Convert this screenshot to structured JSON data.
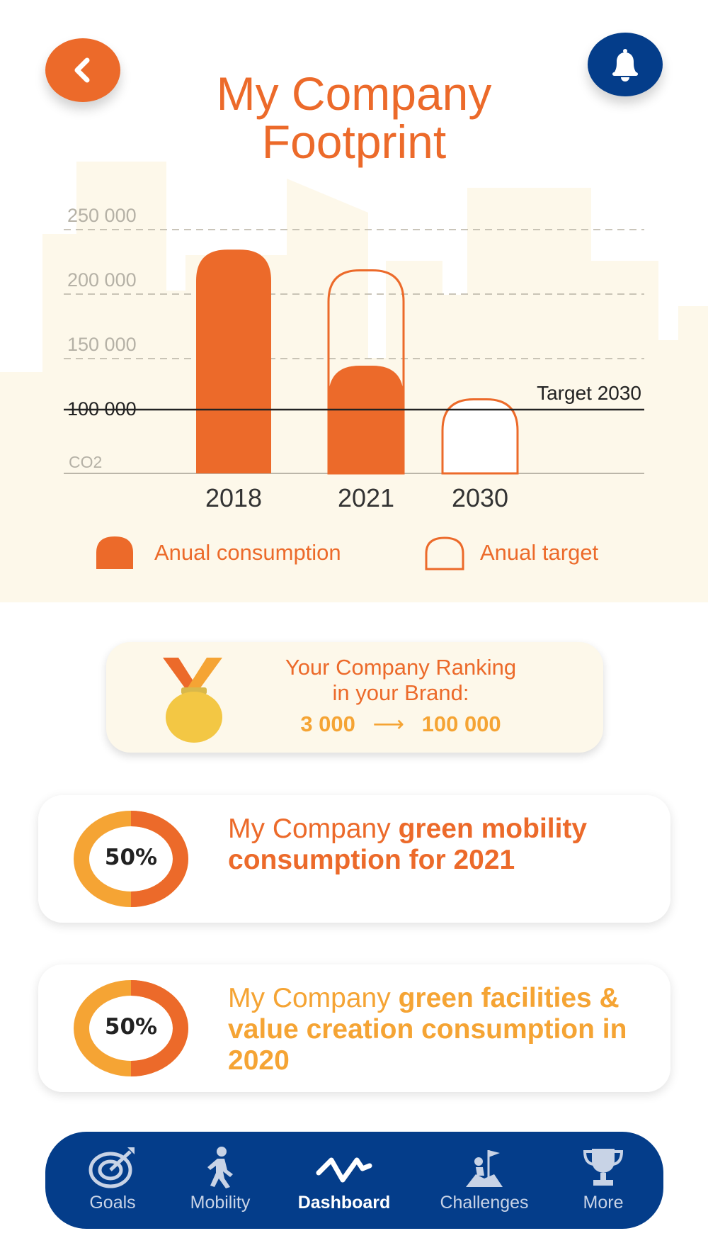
{
  "header": {
    "title_line1": "My Company",
    "title_line2": "Footprint",
    "back_icon": "chevron-left-icon",
    "bell_icon": "bell-icon"
  },
  "colors": {
    "accent": "#EC6A2A",
    "accent_light": "#F5A434",
    "navy": "#043D8A",
    "cream": "#FDF8EA"
  },
  "chart_data": {
    "type": "bar",
    "categories": [
      "2018",
      "2021",
      "2030"
    ],
    "series": [
      {
        "name": "Anual consumption",
        "values": [
          240000,
          150000,
          null
        ]
      },
      {
        "name": "Anual target",
        "values": [
          null,
          225000,
          125000
        ]
      }
    ],
    "y_ticks": [
      "250 000",
      "200 000",
      "150 000",
      "100 000"
    ],
    "ylabel": "CO2",
    "ylim": [
      50000,
      265000
    ],
    "reference_line": {
      "value": 100000,
      "label": "Target 2030"
    },
    "grid": true,
    "legend": [
      "Anual consumption",
      "Anual target"
    ],
    "legend_position": "bottom"
  },
  "ranking": {
    "line1": "Your Company Ranking",
    "line2": "in your Brand:",
    "from": "3 000",
    "arrow": "⟶",
    "to": "100 000",
    "icon": "medal-icon"
  },
  "cards": [
    {
      "percent": "50%",
      "fraction": 0.5,
      "prefix": "My Company ",
      "bold": "green mobility consumption for 2021"
    },
    {
      "percent": "50%",
      "fraction": 0.5,
      "prefix": "My Company ",
      "bold": "green facilities & value creation consumption in 2020"
    }
  ],
  "nav": {
    "items": [
      {
        "label": "Goals",
        "icon": "target-icon"
      },
      {
        "label": "Mobility",
        "icon": "walking-person-icon"
      },
      {
        "label": "Dashboard",
        "icon": "pulse-icon"
      },
      {
        "label": "Challenges",
        "icon": "climber-flag-icon"
      },
      {
        "label": "More",
        "icon": "trophy-icon"
      }
    ],
    "active": "Dashboard"
  }
}
